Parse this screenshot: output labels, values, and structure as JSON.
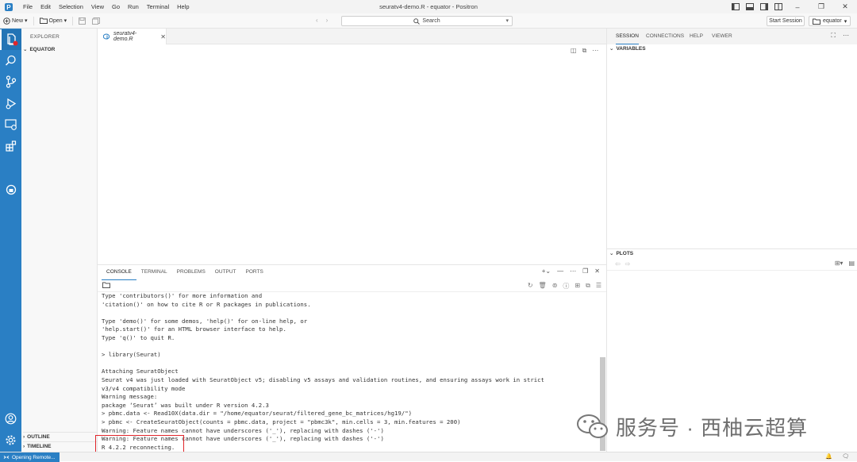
{
  "window": {
    "title": "seuratv4-demo.R - equator - Positron",
    "menu": [
      "File",
      "Edit",
      "Selection",
      "View",
      "Go",
      "Run",
      "Terminal",
      "Help"
    ]
  },
  "toolbar": {
    "new_label": "New",
    "open_label": "Open",
    "search_label": "Search",
    "start_session_label": "Start Session",
    "workspace_label": "equator"
  },
  "sidebar": {
    "header": "EXPLORER",
    "root": "EQUATOR",
    "outline": "OUTLINE",
    "timeline": "TIMELINE"
  },
  "editor": {
    "tab_label": "seuratv4-demo.R"
  },
  "panel": {
    "tabs": [
      "CONSOLE",
      "TERMINAL",
      "PROBLEMS",
      "OUTPUT",
      "PORTS"
    ],
    "active_tab": "CONSOLE",
    "console_lines": [
      "Type 'contributors()' for more information and",
      "'citation()' on how to cite R or R packages in publications.",
      "",
      "Type 'demo()' for some demos, 'help()' for on-line help, or",
      "'help.start()' for an HTML browser interface to help.",
      "Type 'q()' to quit R.",
      "",
      "> library(Seurat)",
      "",
      "Attaching SeuratObject",
      "Seurat v4 was just loaded with SeuratObject v5; disabling v5 assays and validation routines, and ensuring assays work in strict",
      "v3/v4 compatibility mode",
      "Warning message:",
      "package ‘Seurat’ was built under R version 4.2.3",
      "> pbmc.data <- Read10X(data.dir = \"/home/equator/seurat/filtered_gene_bc_matrices/hg19/\")",
      "> pbmc <- CreateSeuratObject(counts = pbmc.data, project = \"pbmc3k\", min.cells = 3, min.features = 200)",
      "Warning: Feature names cannot have underscores ('_'), replacing with dashes ('-')",
      "Warning: Feature names cannot have underscores ('_'), replacing with dashes ('-')",
      "R 4.2.2 reconnecting."
    ]
  },
  "right": {
    "tabs": [
      "SESSION",
      "CONNECTIONS",
      "HELP",
      "VIEWER"
    ],
    "active_tab": "SESSION",
    "variables_label": "VARIABLES",
    "plots_label": "PLOTS"
  },
  "watermark": {
    "text": "服务号 · 西柚云超算"
  },
  "statusbar": {
    "remote_label": "Opening Remote..."
  },
  "colors": {
    "accent": "#2a7fc4",
    "highlight_box": "#e0262b"
  }
}
